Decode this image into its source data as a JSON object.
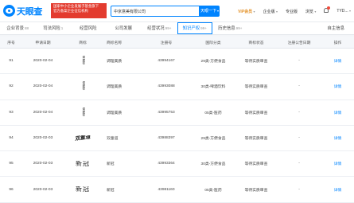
{
  "header": {
    "logo_text": "天眼查",
    "promo_lines": [
      "国家中小企业发展子基金旗下",
      "官方备案企业征信机构"
    ],
    "search_value": "中京意美有限公司",
    "search_button": "天眼一下",
    "nav": {
      "vip": "VIP会员",
      "enterprise": "企业版",
      "pro": "专业版",
      "browse": "浏览",
      "user": "TYD..."
    }
  },
  "tabs": [
    {
      "label": "企业背景",
      "count": "88"
    },
    {
      "label": "司法风险",
      "count": "1"
    },
    {
      "label": "经营风险",
      "count": ""
    },
    {
      "label": "公司发展",
      "count": ""
    },
    {
      "label": "经营状况",
      "count": "99+"
    },
    {
      "label": "知识产权",
      "count": "99+"
    },
    {
      "label": "历史信息",
      "count": "99+"
    },
    {
      "label": "",
      "count": ""
    },
    {
      "label": "",
      "count": ""
    },
    {
      "label": "自主信息",
      "count": ""
    }
  ],
  "active_tab_index": 5,
  "table": {
    "columns": [
      "序号",
      "申请日期",
      "商标",
      "商标名称",
      "注册号",
      "国际分类",
      "商标状态",
      "注册公告日期",
      "操作"
    ],
    "rows": [
      {
        "no": "91",
        "date": "2020-02-04",
        "mark": "调理膏",
        "mark_style": "vert",
        "name": "调理美质",
        "reg": "43994167",
        "class": "29类-方便食品",
        "status": "等待实质审查",
        "announce": "-",
        "action": "详情"
      },
      {
        "no": "92",
        "date": "2020-02-04",
        "mark": "调理膏",
        "mark_style": "vert",
        "name": "调理美质",
        "reg": "43993088",
        "class": "30类-啤酒饮料",
        "status": "等待实质审查",
        "announce": "-",
        "action": "详情"
      },
      {
        "no": "93",
        "date": "2020-02-04",
        "mark": "调理膏",
        "mark_style": "vert",
        "name": "调理美质",
        "reg": "43995753",
        "class": "05类-医药",
        "status": "等待实质审查",
        "announce": "-",
        "action": "详情"
      },
      {
        "no": "94",
        "date": "2020-02-03",
        "mark": "双童道",
        "mark_style": "brush",
        "name": "双童道",
        "reg": "43988397",
        "class": "29类-方便食品",
        "status": "等待实质审查",
        "announce": "-",
        "action": "详情"
      },
      {
        "no": "95",
        "date": "2020-02-03",
        "mark": "新冠",
        "mark_style": "plain",
        "name": "新冠",
        "reg": "43993364",
        "class": "30类-方便食品",
        "status": "等待实质审查",
        "announce": "-",
        "action": "详情"
      },
      {
        "no": "96",
        "date": "2020-02-03",
        "mark": "新冠",
        "mark_style": "plain",
        "name": "新冠",
        "reg": "43981160",
        "class": "05类-医药",
        "status": "等待实质审查",
        "announce": "-",
        "action": "详情"
      }
    ]
  },
  "colors": {
    "accent": "#0084ff",
    "promo": "#e33b2e",
    "vip": "#e4932b"
  }
}
